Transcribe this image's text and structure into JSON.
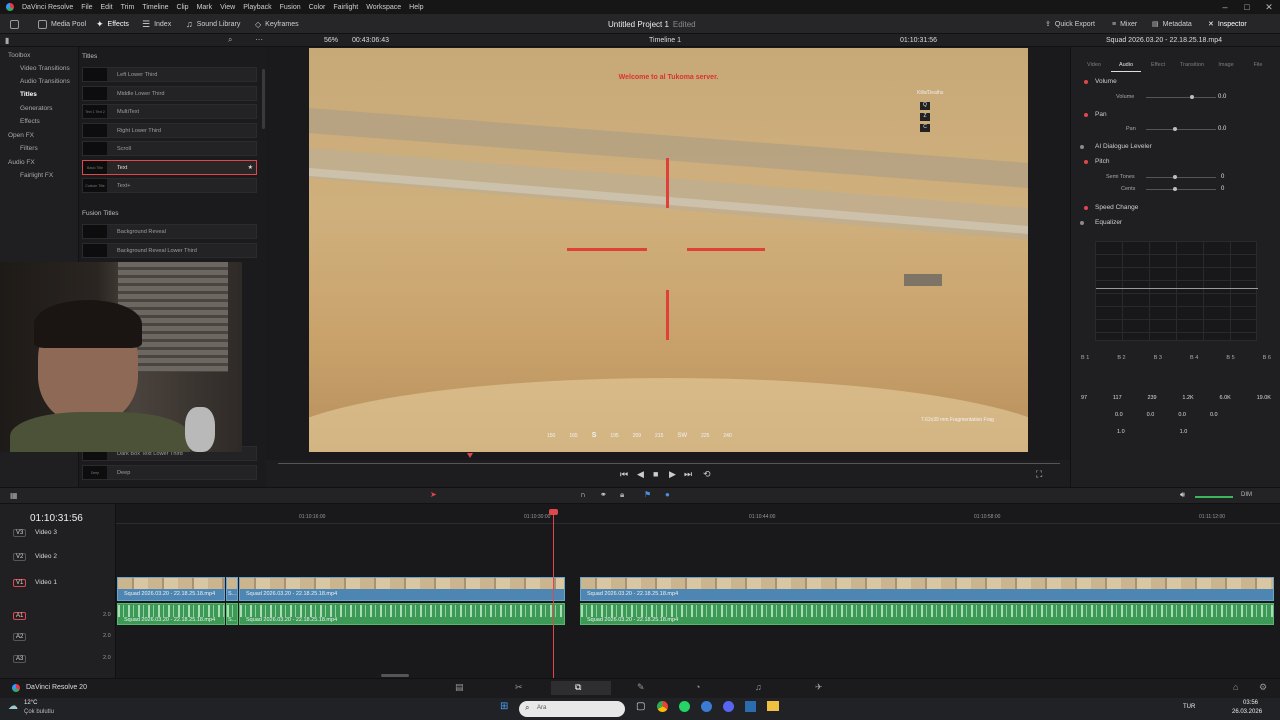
{
  "menubar": {
    "app_name": "DaVinci Resolve",
    "items": [
      "File",
      "Edit",
      "Trim",
      "Timeline",
      "Clip",
      "Mark",
      "View",
      "Playback",
      "Fusion",
      "Color",
      "Fairlight",
      "Workspace",
      "Help"
    ]
  },
  "toolbar": {
    "media_pool": "Media Pool",
    "effects": "Effects",
    "index": "Index",
    "sound_library": "Sound Library",
    "keyframes": "Keyframes",
    "project_title": "Untitled Project 1",
    "project_status": "Edited",
    "quick_export": "Quick Export",
    "mixer": "Mixer",
    "metadata": "Metadata",
    "inspector": "Inspector"
  },
  "subbar": {
    "zoom": "56%",
    "source_timecode": "00:43:06:43",
    "timeline_name": "Timeline 1",
    "record_timecode": "01:10:31:56",
    "clip_name": "Squad 2026.03.20 - 22.18.25.18.mp4"
  },
  "effects_tree": {
    "items": [
      {
        "label": "Toolbox",
        "expanded": true
      },
      {
        "label": "Video Transitions"
      },
      {
        "label": "Audio Transitions"
      },
      {
        "label": "Titles",
        "selected": true
      },
      {
        "label": "Generators"
      },
      {
        "label": "Effects"
      },
      {
        "label": "Open FX"
      },
      {
        "label": "Filters"
      },
      {
        "label": "Audio FX"
      },
      {
        "label": "Fairlight FX"
      }
    ]
  },
  "titles_panel": {
    "heading": "Titles",
    "items": [
      {
        "label": "Left Lower Third",
        "thumb": ""
      },
      {
        "label": "Middle Lower Third",
        "thumb": ""
      },
      {
        "label": "MultiText",
        "thumb": "Text 1 Text 2"
      },
      {
        "label": "Right Lower Third",
        "thumb": ""
      },
      {
        "label": "Scroll",
        "thumb": ""
      },
      {
        "label": "Text",
        "thumb": "Basic Title",
        "selected": true
      },
      {
        "label": "Text+",
        "thumb": "Custom Title"
      }
    ],
    "fusion_heading": "Fusion Titles",
    "fusion_items": [
      {
        "label": "Background Reveal"
      },
      {
        "label": "Background Reveal Lower Third"
      },
      {
        "label": "Dark Box Text Lower Third"
      },
      {
        "label": "Deep",
        "thumb": "Deep"
      }
    ]
  },
  "viewer": {
    "overlay_message": "Welcome to al Tukoma server.",
    "scoreboard_header": "Kills/Deaths",
    "scoreboard_keys": [
      "Q",
      "Z",
      "C"
    ],
    "compass": [
      "150",
      "165",
      "S",
      "195",
      "209",
      "215",
      "SW",
      "225",
      "240"
    ],
    "ammo_text": "7.62x39 mm Fragmentation Frag",
    "colors": {
      "crosshair": "#e0403a",
      "message": "#d9332e"
    }
  },
  "inspector": {
    "tabs": [
      "Video",
      "Audio",
      "Effect",
      "Transition",
      "Image",
      "File"
    ],
    "active_tab": "Audio",
    "sections": {
      "volume": {
        "title": "Volume",
        "label": "Volume",
        "value": "0.0"
      },
      "pan": {
        "title": "Pan",
        "label": "Pan",
        "value": "0.0"
      },
      "dialogue": {
        "title": "AI Dialogue Leveler"
      },
      "pitch": {
        "title": "Pitch",
        "semitones_label": "Semi Tones",
        "semitones": "0",
        "cents_label": "Cents",
        "cents": "0"
      },
      "speed": {
        "title": "Speed Change"
      },
      "equalizer": {
        "title": "Equalizer",
        "bands": [
          "B 1",
          "B 2",
          "B 3",
          "B 4",
          "B 5",
          "B 6"
        ],
        "freq": [
          "97",
          "117",
          "239",
          "1.2K",
          "6.0K",
          "19.0K"
        ],
        "gain": [
          "",
          "0.0",
          "0.0",
          "0.0",
          "0.0",
          ""
        ],
        "q": [
          "",
          "1.0",
          "",
          "1.0",
          "",
          ""
        ]
      }
    }
  },
  "timeline": {
    "timecode": "01:10:31:56",
    "ruler": [
      "01:10:16:00",
      "01:10:30:00",
      "01:10:44:00",
      "01:10:58:00",
      "01:11:12:00"
    ],
    "tracks": [
      {
        "id": "V3",
        "name": "Video 3"
      },
      {
        "id": "V2",
        "name": "Video 2"
      },
      {
        "id": "V1",
        "name": "Video 1"
      },
      {
        "id": "A1",
        "level": "2.0"
      },
      {
        "id": "A2",
        "level": "2.0"
      },
      {
        "id": "A3",
        "level": "2.0"
      }
    ],
    "clips": [
      "Squad 2026.03.20 - 22.18.25.18.mp4",
      "S...",
      "Squad 2026.03.20 - 22.18.25.18.mp4",
      "Squad 2026.03.20 - 22.18.25.18.mp4"
    ],
    "colors": {
      "video_clip": "#4d86b3",
      "audio_clip": "#3d9a56",
      "playhead": "#e0474c"
    }
  },
  "pagebar": {
    "brand": "DaVinci Resolve 20"
  },
  "taskbar": {
    "weather_temp": "12°C",
    "weather_desc": "Çok bulutlu",
    "search_placeholder": "Ara",
    "lang": "TUR",
    "time": "03:56",
    "date": "26.03.2026"
  }
}
